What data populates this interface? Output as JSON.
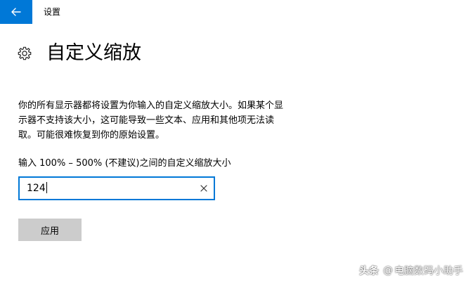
{
  "window": {
    "title": "设置",
    "accent_color": "#0078d7"
  },
  "navigation": {
    "back_icon": "arrow-left-icon"
  },
  "header": {
    "icon": "gear-icon",
    "title": "自定义缩放"
  },
  "description": {
    "lines": [
      "你的所有显示器都将设置为你输入的自定义缩放大小。如果某个显",
      "示器不支持该大小，这可能导致一些文本、应用和其他项无法读",
      "取。可能很难恢复到你的原始设置。"
    ]
  },
  "scale_field": {
    "label": "输入 100% – 500% (不建议)之间的自定义缩放大小",
    "value": "124",
    "clear_icon": "close-icon"
  },
  "actions": {
    "apply_label": "应用",
    "apply_color": "#cccccc"
  },
  "watermark": {
    "brand": "头条",
    "at": "@",
    "account": "电脑数码小助手"
  }
}
